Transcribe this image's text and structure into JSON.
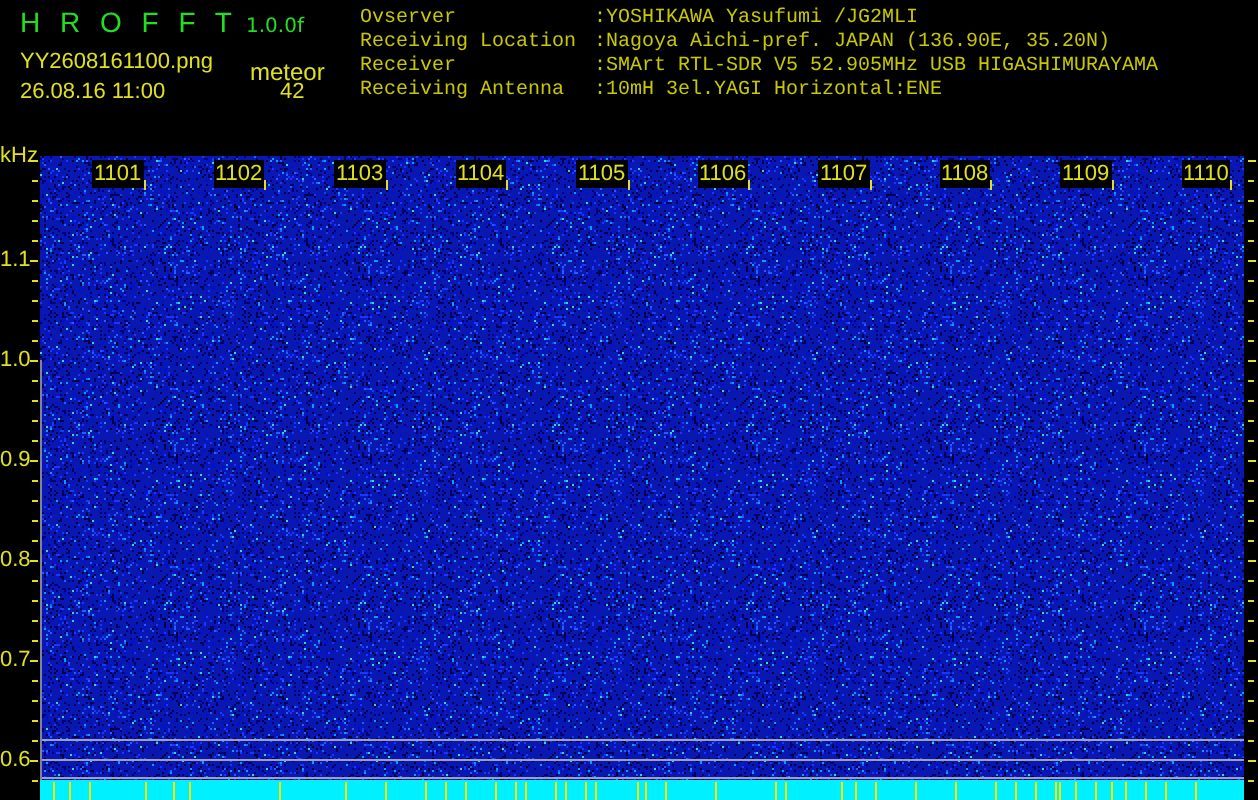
{
  "header": {
    "app_title": "H R O F F T",
    "version": "1.0.0f",
    "filename": "YY2608161100.png",
    "datetime": "26.08.16 11:00",
    "count_label": "meteor",
    "count": "42"
  },
  "info": [
    {
      "label": "Ovserver",
      "value": ":YOSHIKAWA Yasufumi /JG2MLI"
    },
    {
      "label": "Receiving Location",
      "value": ":Nagoya Aichi-pref. JAPAN (136.90E, 35.20N)"
    },
    {
      "label": "Receiver",
      "value": ":SMArt RTL-SDR V5 52.905MHz USB HIGASHIMURAYAMA"
    },
    {
      "label": "Receiving Antenna",
      "value": ":10mH 3el.YAGI Horizontal:ENE"
    }
  ],
  "spectrogram": {
    "y_unit": "kHz",
    "y_labels": [
      "1.1",
      "1.0",
      "0.9",
      "0.8",
      "0.7",
      "0.6"
    ],
    "time_labels": [
      "1101",
      "1102",
      "1103",
      "1104",
      "1105",
      "1106",
      "1107",
      "1108",
      "1109",
      "1110"
    ]
  }
}
